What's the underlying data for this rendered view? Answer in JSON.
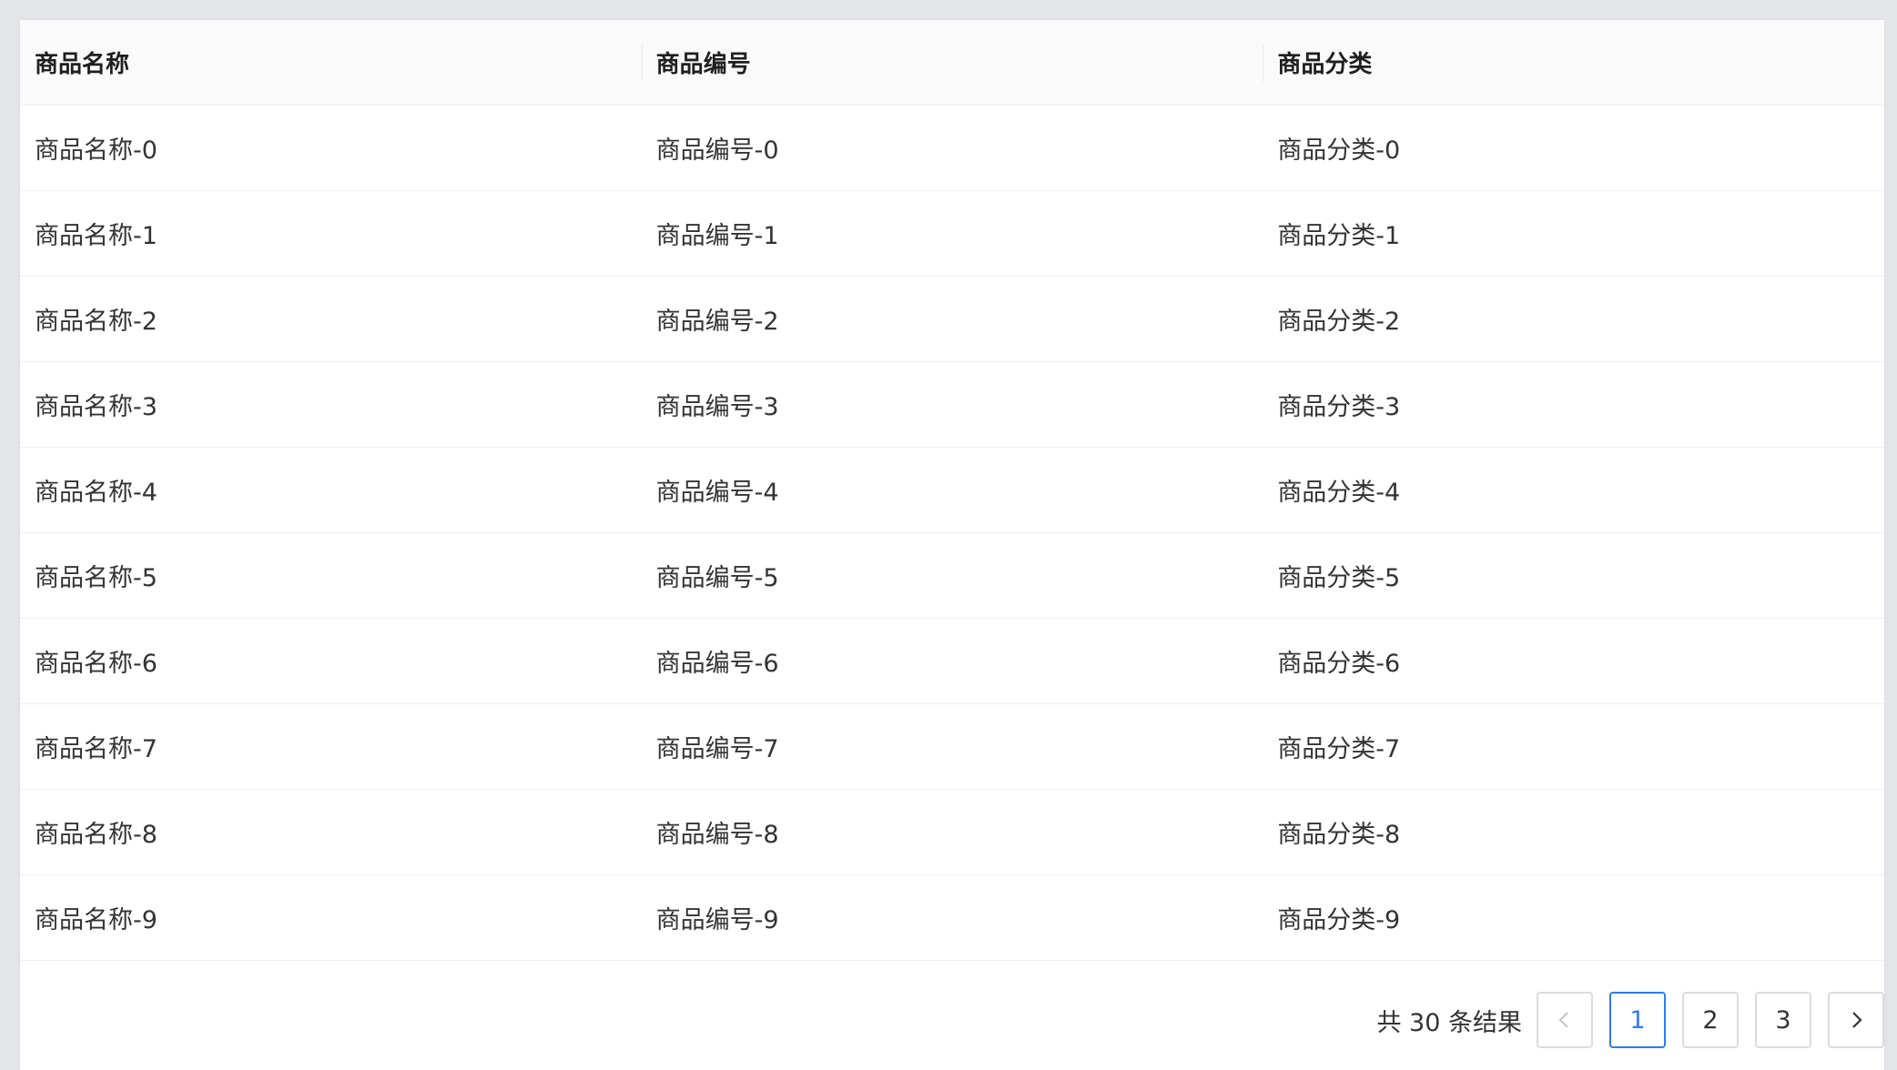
{
  "table": {
    "columns": [
      "商品名称",
      "商品编号",
      "商品分类"
    ],
    "rows": [
      [
        "商品名称-0",
        "商品编号-0",
        "商品分类-0"
      ],
      [
        "商品名称-1",
        "商品编号-1",
        "商品分类-1"
      ],
      [
        "商品名称-2",
        "商品编号-2",
        "商品分类-2"
      ],
      [
        "商品名称-3",
        "商品编号-3",
        "商品分类-3"
      ],
      [
        "商品名称-4",
        "商品编号-4",
        "商品分类-4"
      ],
      [
        "商品名称-5",
        "商品编号-5",
        "商品分类-5"
      ],
      [
        "商品名称-6",
        "商品编号-6",
        "商品分类-6"
      ],
      [
        "商品名称-7",
        "商品编号-7",
        "商品分类-7"
      ],
      [
        "商品名称-8",
        "商品编号-8",
        "商品分类-8"
      ],
      [
        "商品名称-9",
        "商品编号-9",
        "商品分类-9"
      ]
    ]
  },
  "pagination": {
    "total_text": "共 30 条结果",
    "pages": [
      "1",
      "2",
      "3"
    ],
    "current_page": "1",
    "prev_icon": "chevron-left-icon",
    "next_icon": "chevron-right-icon"
  },
  "colors": {
    "accent": "#2f7bea",
    "header_bg": "#fafafa",
    "border": "#dcdcdc"
  }
}
